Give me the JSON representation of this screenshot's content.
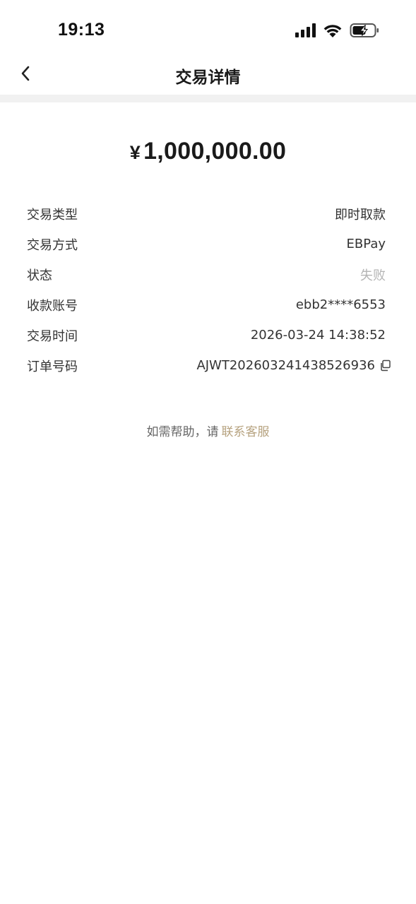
{
  "status_bar": {
    "time": "19:13",
    "icons": [
      "signal-icon",
      "wifi-icon",
      "battery-charging-icon"
    ]
  },
  "header": {
    "title": "交易详情",
    "back_icon": "chevron-left-icon"
  },
  "amount": {
    "currency": "¥",
    "value": "1,000,000.00"
  },
  "details": [
    {
      "label": "交易类型",
      "value": "即时取款"
    },
    {
      "label": "交易方式",
      "value": "EBPay"
    },
    {
      "label": "状态",
      "value": "失败"
    },
    {
      "label": "收款账号",
      "value": "ebb2****6553"
    },
    {
      "label": "交易时间",
      "value": "2026-03-24 14:38:52"
    },
    {
      "label": "订单号码",
      "value": "AJWT202603241438526936"
    }
  ],
  "help": {
    "text": "如需帮助，请",
    "link": "联系客服"
  },
  "colors": {
    "divider": "#f1f1f1",
    "failed": "#b5b5b5",
    "link": "#b6a27f",
    "text": "#333333"
  }
}
